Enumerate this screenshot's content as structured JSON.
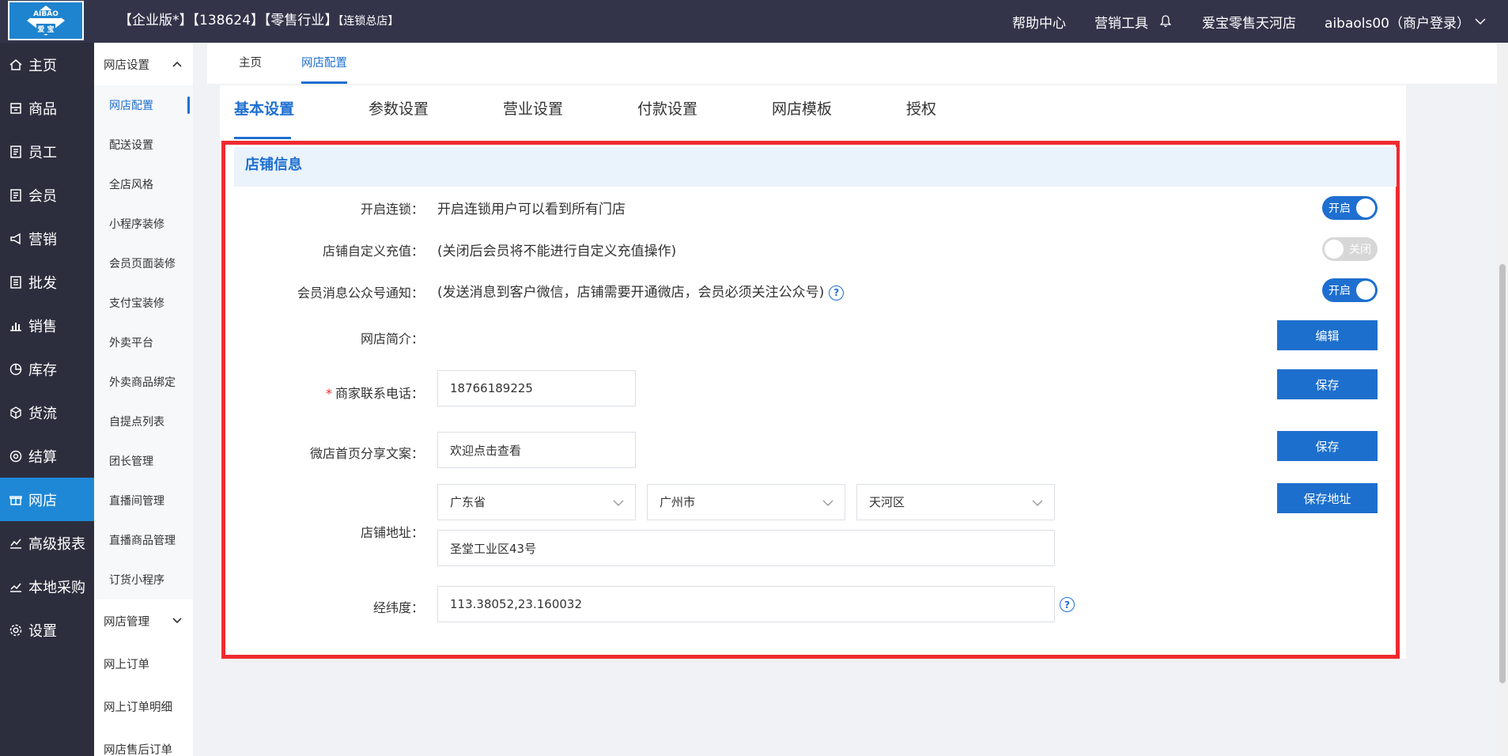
{
  "header": {
    "logo_text_top": "AIBAO",
    "logo_text_bottom": "爱 宝",
    "title": "【企业版*】【138624】【零售行业】",
    "title_suffix": "【连锁总店】",
    "help_center": "帮助中心",
    "marketing_tools": "营销工具",
    "store_name": "爱宝零售天河店",
    "user": "aibaols00（商户登录）"
  },
  "sidebar": {
    "items": [
      {
        "label": "主页",
        "icon": "home-icon"
      },
      {
        "label": "商品",
        "icon": "goods-icon"
      },
      {
        "label": "员工",
        "icon": "staff-icon"
      },
      {
        "label": "会员",
        "icon": "member-icon"
      },
      {
        "label": "营销",
        "icon": "megaphone-icon"
      },
      {
        "label": "批发",
        "icon": "list-icon"
      },
      {
        "label": "销售",
        "icon": "bar-chart-icon"
      },
      {
        "label": "库存",
        "icon": "pie-chart-icon"
      },
      {
        "label": "货流",
        "icon": "cube-icon"
      },
      {
        "label": "结算",
        "icon": "settle-icon"
      },
      {
        "label": "网店",
        "icon": "gift-icon"
      },
      {
        "label": "高级报表",
        "icon": "line-chart-icon"
      },
      {
        "label": "本地采购",
        "icon": "trend-icon"
      },
      {
        "label": "设置",
        "icon": "gear-icon"
      }
    ],
    "active_index": 10
  },
  "subnav": {
    "group1": "网店设置",
    "group1_items": [
      "网店配置",
      "配送设置",
      "全店风格",
      "小程序装修",
      "会员页面装修",
      "支付宝装修",
      "外卖平台",
      "外卖商品绑定",
      "自提点列表",
      "团长管理",
      "直播间管理",
      "直播商品管理",
      "订货小程序"
    ],
    "group2": "网店管理",
    "group2_items": [
      "网上订单",
      "网上订单明细",
      "网店售后订单"
    ]
  },
  "page_tabs": [
    "主页",
    "网店配置"
  ],
  "tabs": [
    "基本设置",
    "参数设置",
    "营业设置",
    "付款设置",
    "网店模板",
    "授权"
  ],
  "section": {
    "title": "店铺信息",
    "chain": {
      "label": "开启连锁：",
      "desc": "开启连锁用户可以看到所有门店",
      "toggle": "开启"
    },
    "recharge": {
      "label": "店铺自定义充值：",
      "desc": "(关闭后会员将不能进行自定义充值操作)",
      "toggle": "关闭"
    },
    "notify": {
      "label": "会员消息公众号通知：",
      "desc": "(发送消息到客户微信，店铺需要开通微店，会员必须关注公众号)",
      "toggle": "开启"
    },
    "intro": {
      "label": "网店简介：",
      "button": "编辑"
    },
    "phone": {
      "required": "*",
      "label": "商家联系电话：",
      "value": "18766189225",
      "button": "保存"
    },
    "share": {
      "label": "微店首页分享文案：",
      "value": "欢迎点击查看",
      "button": "保存"
    },
    "address": {
      "label": "店铺地址：",
      "province": "广东省",
      "city": "广州市",
      "district": "天河区",
      "detail": "圣堂工业区43号",
      "button": "保存地址"
    },
    "coords": {
      "label": "经纬度：",
      "value": "113.38052,23.160032"
    }
  },
  "colors": {
    "accent": "#1e6fd0",
    "highlight": "#ef2b2f",
    "topbar": "#33344a",
    "sidebar": "#2d2e3d"
  }
}
